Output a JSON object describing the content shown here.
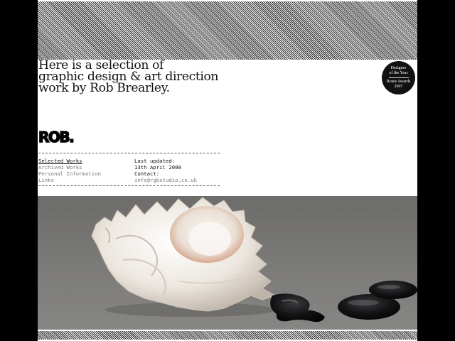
{
  "intro": {
    "lines": [
      "Here is a selection of",
      "graphic design & art direction",
      "work by Rob Brearley."
    ]
  },
  "award": {
    "line1": "Designer",
    "line2": "of the Year",
    "line3": "Roses Awards",
    "line4": "2007"
  },
  "logo": {
    "text": "ROB."
  },
  "nav": {
    "items": [
      {
        "label": "Selected Works",
        "active": true
      },
      {
        "label": "Archived Works",
        "active": false
      },
      {
        "label": "Personal Information",
        "active": false
      },
      {
        "label": "Links",
        "active": false
      }
    ]
  },
  "meta": {
    "updated_label": "Last updated:",
    "updated_date": "13th April 2008",
    "contact_label": "Contact:",
    "email": "info@rgbstudio.co.uk"
  },
  "colors": {
    "background": "#000000",
    "page": "#ffffff",
    "text": "#111111",
    "muted_link": "#7a7a7a",
    "photo_backdrop": "#7a7977"
  }
}
